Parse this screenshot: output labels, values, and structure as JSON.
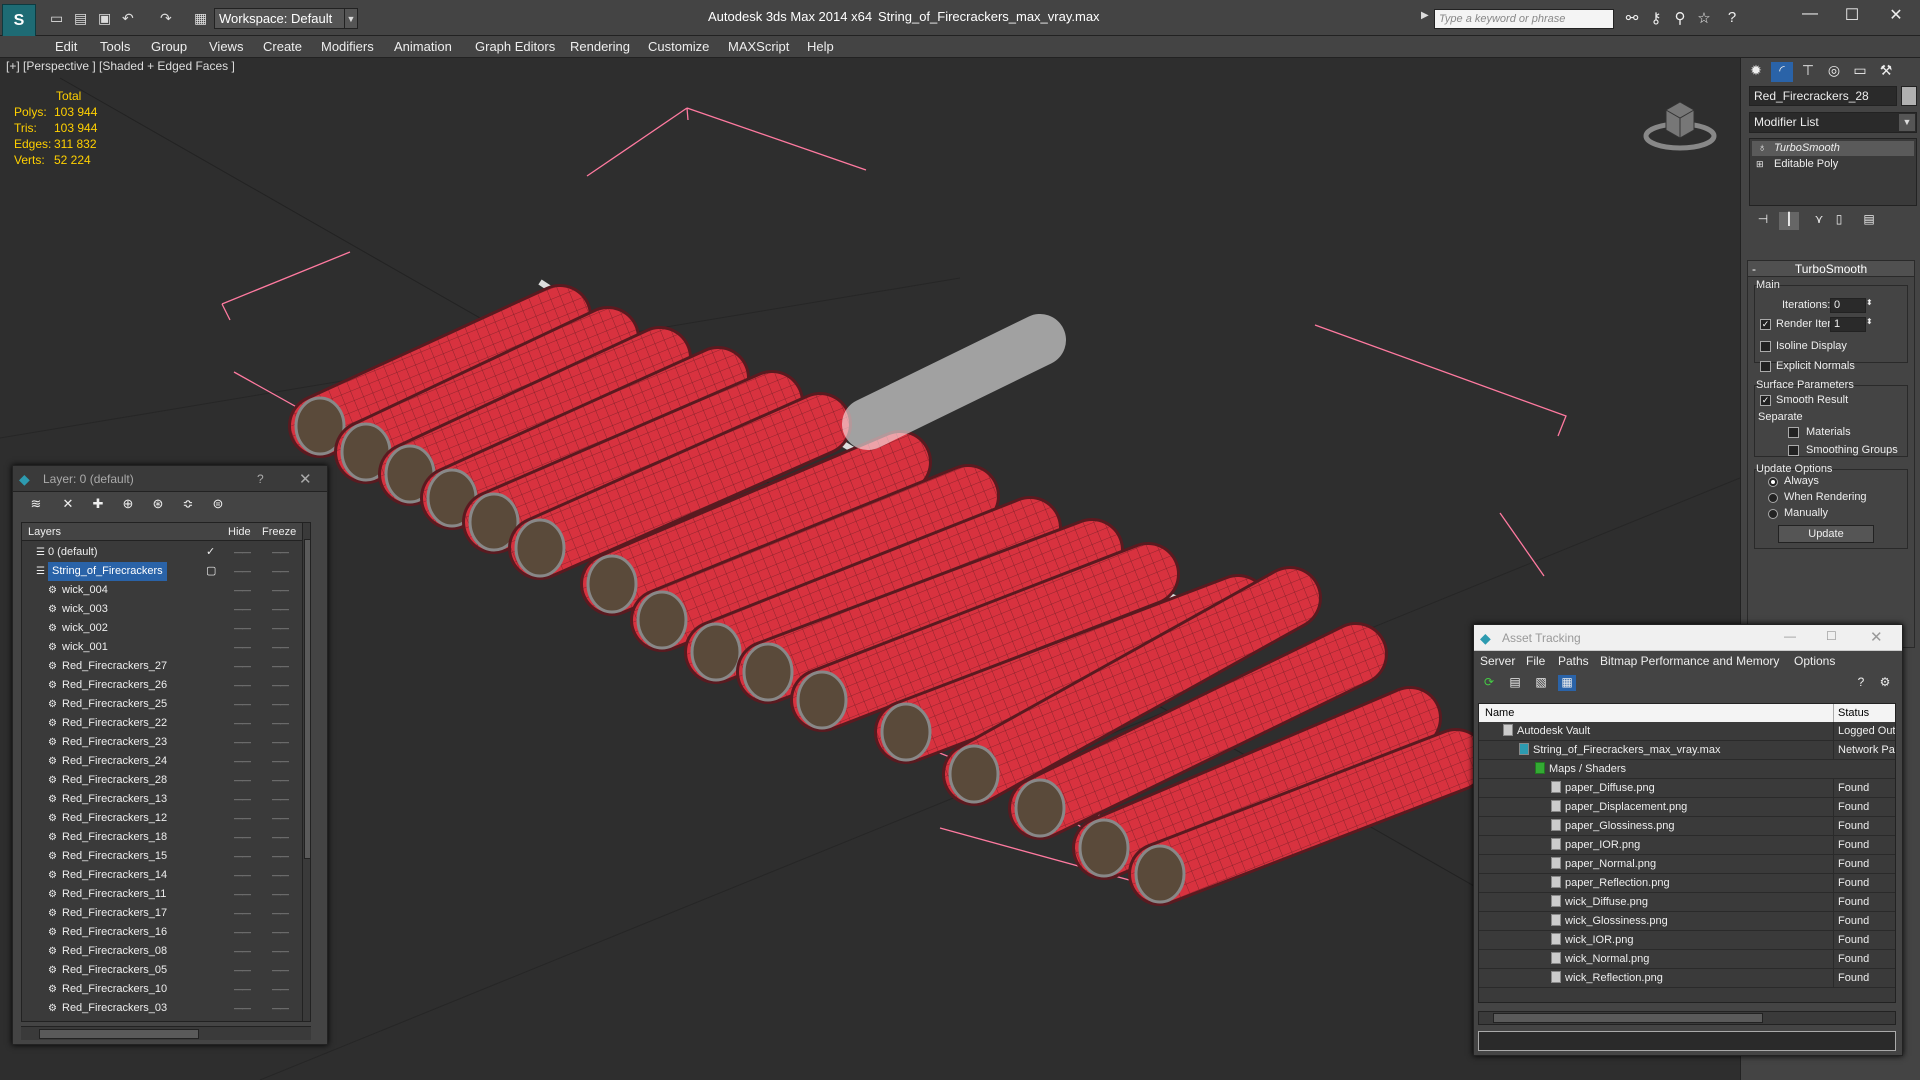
{
  "titlebar": {
    "workspace": "Workspace: Default",
    "app_title": "Autodesk 3ds Max  2014 x64",
    "file_title": "String_of_Firecrackers_max_vray.max",
    "search_placeholder": "Type a keyword or phrase"
  },
  "menubar": [
    "Edit",
    "Tools",
    "Group",
    "Views",
    "Create",
    "Modifiers",
    "Animation",
    "Graph Editors",
    "Rendering",
    "Customize",
    "MAXScript",
    "Help"
  ],
  "viewport": {
    "label": "[+] [Perspective ] [Shaded + Edged Faces ]",
    "stats": {
      "header": "Total",
      "rows": [
        {
          "label": "Polys:",
          "value": "103 944"
        },
        {
          "label": "Tris:",
          "value": "103 944"
        },
        {
          "label": "Edges:",
          "value": "311 832"
        },
        {
          "label": "Verts:",
          "value": "52 224"
        }
      ]
    }
  },
  "command_panel": {
    "object_name": "Red_Firecrackers_28",
    "modifier_list": "Modifier List",
    "stack": [
      "TurboSmooth",
      "Editable Poly"
    ],
    "rollout": {
      "title": "TurboSmooth",
      "main": "Main",
      "iterations_label": "Iterations:",
      "iterations": "0",
      "render_iters_label": "Render Iters:",
      "render_iters": "1",
      "isoline": "Isoline Display",
      "explicit_normals": "Explicit Normals",
      "surface_params": "Surface Parameters",
      "smooth_result": "Smooth Result",
      "separate": "Separate",
      "materials": "Materials",
      "smoothing_groups": "Smoothing Groups",
      "update_options": "Update Options",
      "always": "Always",
      "when_rendering": "When Rendering",
      "manually": "Manually",
      "update_button": "Update"
    }
  },
  "layer_window": {
    "title": "Layer: 0 (default)",
    "help": "?",
    "columns": {
      "layers": "Layers",
      "hide": "Hide",
      "freeze": "Freeze"
    },
    "rows": [
      {
        "name": "0 (default)",
        "level": 1
      },
      {
        "name": "String_of_Firecrackers",
        "level": 1,
        "selected": true
      },
      {
        "name": "wick_004",
        "level": 2
      },
      {
        "name": "wick_003",
        "level": 2
      },
      {
        "name": "wick_002",
        "level": 2
      },
      {
        "name": "wick_001",
        "level": 2
      },
      {
        "name": "Red_Firecrackers_27",
        "level": 2
      },
      {
        "name": "Red_Firecrackers_26",
        "level": 2
      },
      {
        "name": "Red_Firecrackers_25",
        "level": 2
      },
      {
        "name": "Red_Firecrackers_22",
        "level": 2
      },
      {
        "name": "Red_Firecrackers_23",
        "level": 2
      },
      {
        "name": "Red_Firecrackers_24",
        "level": 2
      },
      {
        "name": "Red_Firecrackers_28",
        "level": 2
      },
      {
        "name": "Red_Firecrackers_13",
        "level": 2
      },
      {
        "name": "Red_Firecrackers_12",
        "level": 2
      },
      {
        "name": "Red_Firecrackers_18",
        "level": 2
      },
      {
        "name": "Red_Firecrackers_15",
        "level": 2
      },
      {
        "name": "Red_Firecrackers_14",
        "level": 2
      },
      {
        "name": "Red_Firecrackers_11",
        "level": 2
      },
      {
        "name": "Red_Firecrackers_17",
        "level": 2
      },
      {
        "name": "Red_Firecrackers_16",
        "level": 2
      },
      {
        "name": "Red_Firecrackers_08",
        "level": 2
      },
      {
        "name": "Red_Firecrackers_05",
        "level": 2
      },
      {
        "name": "Red_Firecrackers_10",
        "level": 2
      },
      {
        "name": "Red_Firecrackers_03",
        "level": 2
      }
    ]
  },
  "asset_window": {
    "title": "Asset Tracking",
    "menu": [
      "Server",
      "File",
      "Paths",
      "Bitmap Performance and Memory",
      "Options"
    ],
    "columns": {
      "name": "Name",
      "status": "Status"
    },
    "rows": [
      {
        "name": "Autodesk Vault",
        "status": "Logged Out",
        "level": 1
      },
      {
        "name": "String_of_Firecrackers_max_vray.max",
        "status": "Network Path",
        "level": 2
      },
      {
        "name": "Maps / Shaders",
        "status": "",
        "level": 3
      },
      {
        "name": "paper_Diffuse.png",
        "status": "Found",
        "level": 4
      },
      {
        "name": "paper_Displacement.png",
        "status": "Found",
        "level": 4
      },
      {
        "name": "paper_Glossiness.png",
        "status": "Found",
        "level": 4
      },
      {
        "name": "paper_IOR.png",
        "status": "Found",
        "level": 4
      },
      {
        "name": "paper_Normal.png",
        "status": "Found",
        "level": 4
      },
      {
        "name": "paper_Reflection.png",
        "status": "Found",
        "level": 4
      },
      {
        "name": "wick_Diffuse.png",
        "status": "Found",
        "level": 4
      },
      {
        "name": "wick_Glossiness.png",
        "status": "Found",
        "level": 4
      },
      {
        "name": "wick_IOR.png",
        "status": "Found",
        "level": 4
      },
      {
        "name": "wick_Normal.png",
        "status": "Found",
        "level": 4
      },
      {
        "name": "wick_Reflection.png",
        "status": "Found",
        "level": 4
      }
    ]
  },
  "colors": {
    "firecracker": "#d8323f",
    "bbox": "#ff7aa0",
    "stats": "#ffd000",
    "selection": "#2a63a8"
  }
}
